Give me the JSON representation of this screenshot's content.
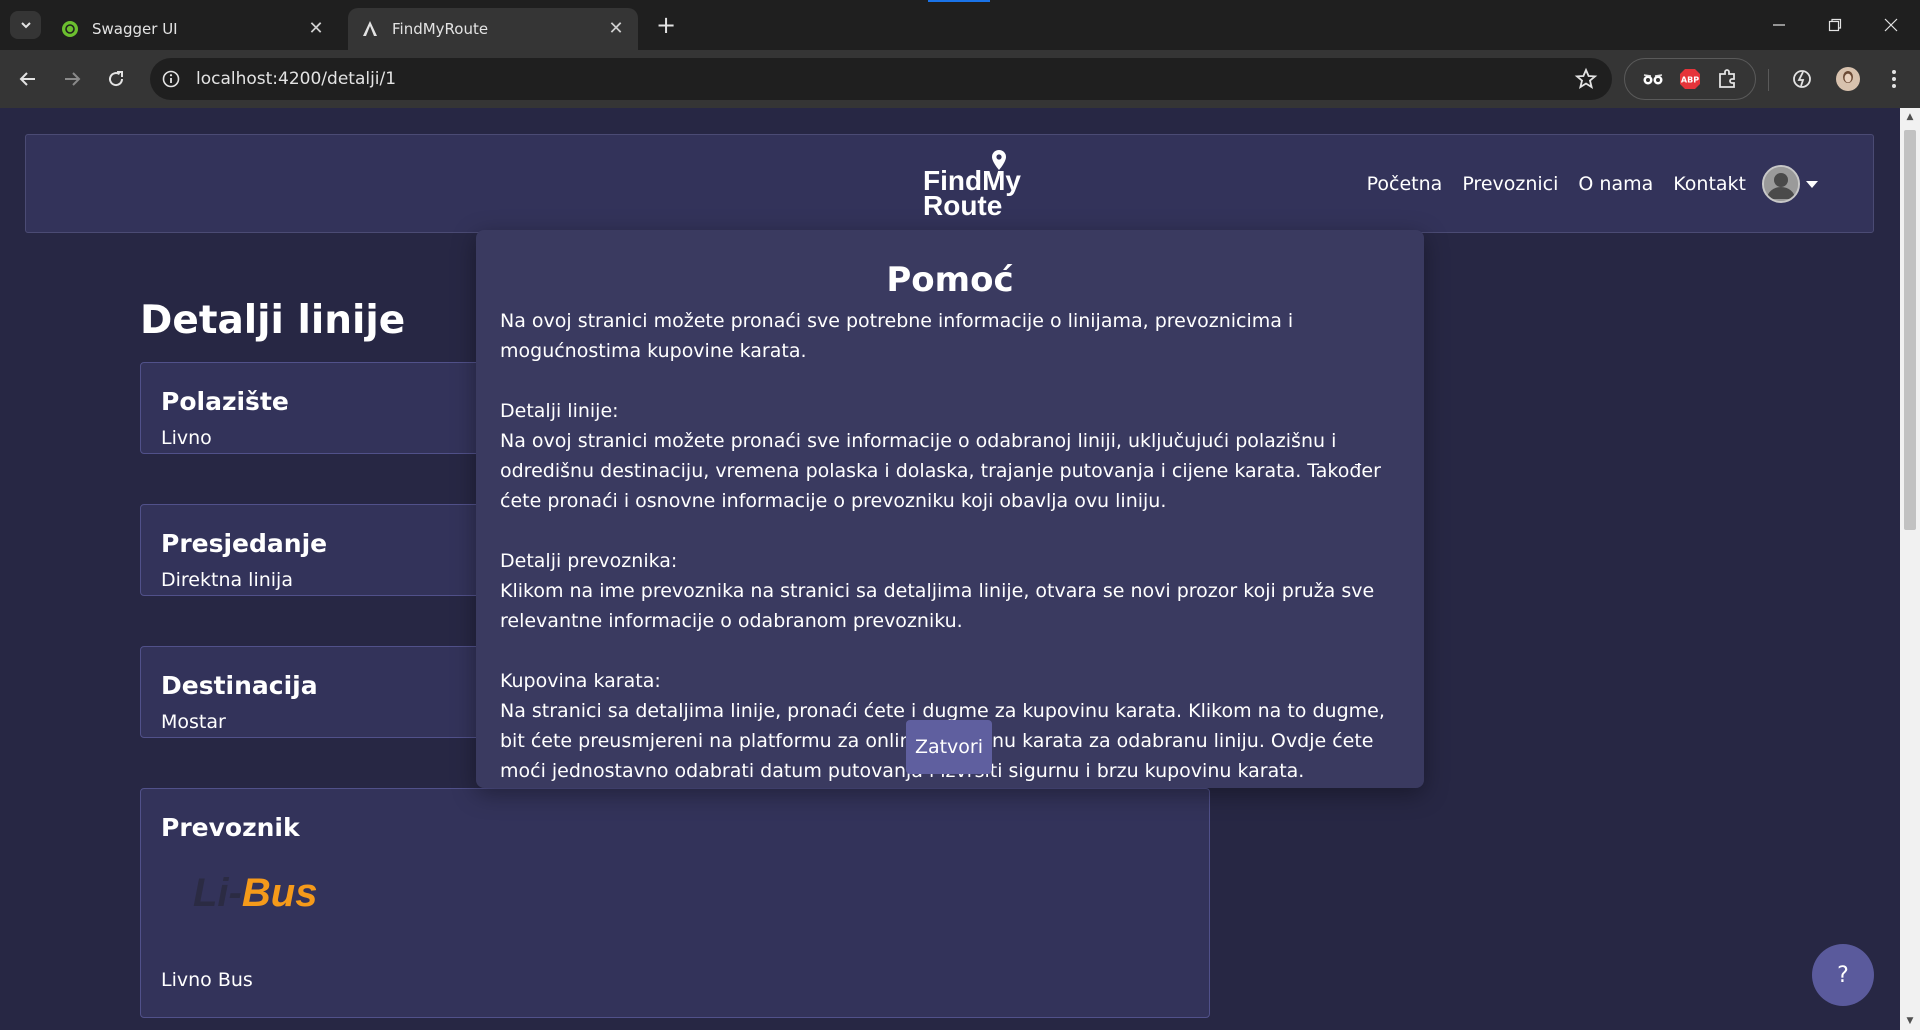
{
  "browser": {
    "tabs": [
      {
        "title": "Swagger UI",
        "active": false
      },
      {
        "title": "FindMyRoute",
        "active": true
      }
    ],
    "url": "localhost:4200/detalji/1",
    "new_tab_label": "+",
    "ext_abp_label": "ABP"
  },
  "site": {
    "logo_line1": "FindMy",
    "logo_line2": "Route",
    "nav": {
      "home": "Početna",
      "carriers": "Prevoznici",
      "about": "O nama",
      "contact": "Kontakt"
    }
  },
  "page": {
    "title": "Detalji linije",
    "cards": {
      "origin": {
        "label": "Polazište",
        "value": "Livno"
      },
      "transfer": {
        "label": "Presjedanje",
        "value": "Direktna linija"
      },
      "destination": {
        "label": "Destinacija",
        "value": "Mostar"
      },
      "carrier": {
        "label": "Prevoznik",
        "logo_part1": "Li-",
        "logo_part2": "Bus",
        "value": "Livno Bus"
      }
    },
    "help_button": "?"
  },
  "modal": {
    "title": "Pomoć",
    "intro": "Na ovoj stranici možete pronaći sve potrebne informacije o linijama, prevoznicima i mogućnostima kupovine karata.",
    "sections": [
      {
        "heading": "Detalji linije:",
        "text": "Na ovoj stranici možete pronaći sve informacije o odabranoj liniji, uključujući polazišnu i odredišnu destinaciju, vremena polaska i dolaska, trajanje putovanja i cijene karata. Također ćete pronaći i osnovne informacije o prevozniku koji obavlja ovu liniju."
      },
      {
        "heading": "Detalji prevoznika:",
        "text": "Klikom na ime prevoznika na stranici sa detaljima linije, otvara se novi prozor koji pruža sve relevantne informacije o odabranom prevozniku."
      },
      {
        "heading": "Kupovina karata:",
        "text": "Na stranici sa detaljima linije, pronaći ćete i dugme za kupovinu karata. Klikom na to dugme, bit ćete preusmjereni na platformu za online kupovinu karata za odabranu liniju. Ovdje ćete moći jednostavno odabrati datum putovanja i izvršiti sigurnu i brzu kupovinu karata."
      }
    ],
    "close_label": "Zatvori"
  },
  "colors": {
    "page_bg": "#272744",
    "navbar_bg": "#33335a",
    "card_bg": "#33335a",
    "modal_bg": "#3a3a60",
    "button_bg": "#5f5f9f",
    "logo_orange": "#f59a1a"
  }
}
